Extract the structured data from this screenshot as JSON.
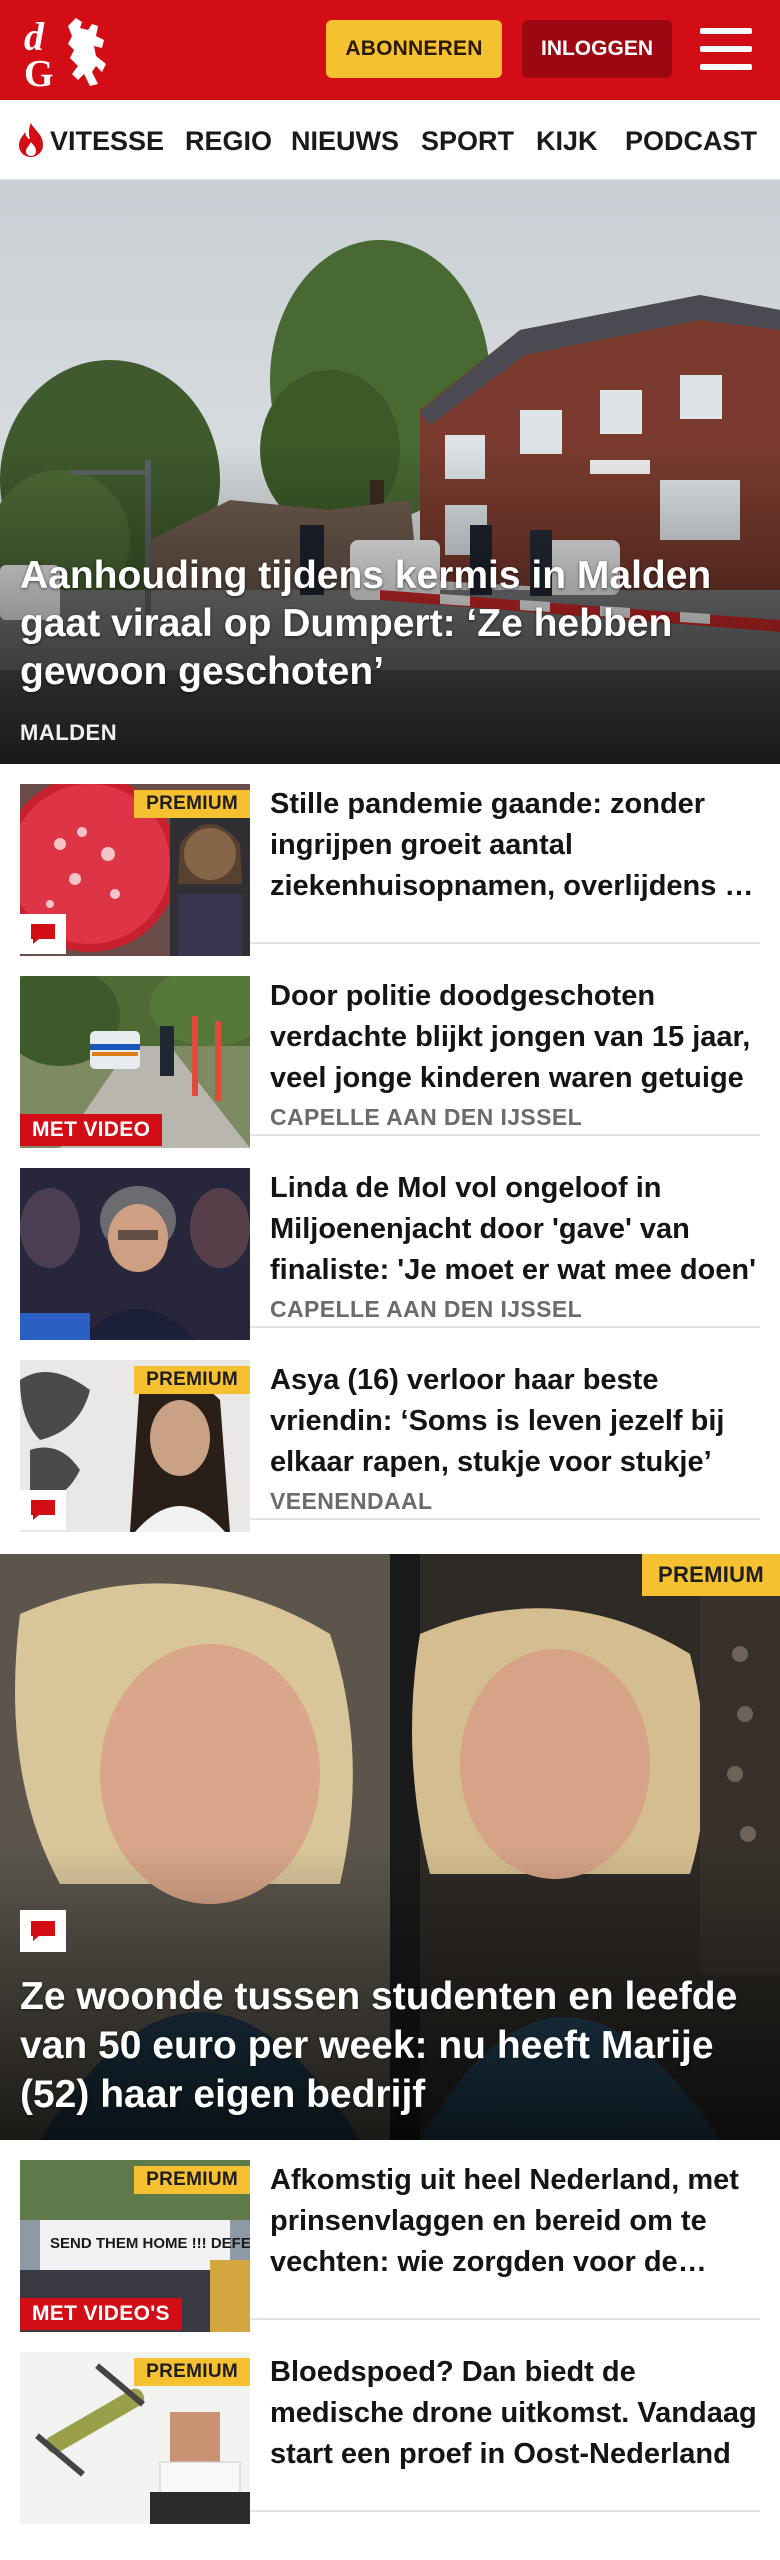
{
  "header": {
    "logo_text": "dG",
    "subscribe_label": "ABONNEREN",
    "login_label": "INLOGGEN"
  },
  "nav": {
    "items": [
      "VITESSE",
      "REGIO",
      "NIEUWS",
      "SPORT",
      "KIJK",
      "PODCAST"
    ]
  },
  "hero": {
    "title": "Aanhouding tijdens kermis in Malden gaat viraal op Dumpert: ‘Ze hebben gewoon geschoten’",
    "location": "MALDEN"
  },
  "articles": [
    {
      "title": "Stille pandemie gaande: zonder ingrijpen groeit aantal ziekenhuisopnamen, overlijdens en kosten explosief",
      "location": "",
      "premium_badge": "PREMIUM",
      "video_badge": "",
      "has_comment_icon": true
    },
    {
      "title": "Door politie doodgeschoten verdachte blijkt jongen van 15 jaar, veel jonge kinderen waren getuige",
      "location": "CAPELLE AAN DEN IJSSEL",
      "premium_badge": "",
      "video_badge": "MET VIDEO",
      "has_comment_icon": false
    },
    {
      "title": "Linda de Mol vol ongeloof in Miljoenenjacht door 'gave' van finaliste: 'Je moet er wat mee doen'",
      "location": "CAPELLE AAN DEN IJSSEL",
      "premium_badge": "",
      "video_badge": "",
      "has_comment_icon": false
    },
    {
      "title": "Asya (16) verloor haar beste vriendin: ‘Soms is leven jezelf bij elkaar rapen, stukje voor stukje’",
      "location": "VEENENDAAL",
      "premium_badge": "PREMIUM",
      "video_badge": "",
      "has_comment_icon": true
    }
  ],
  "feature": {
    "premium_badge": "PREMIUM",
    "title": "Ze woonde tussen studenten en leefde van 50 euro per week: nu heeft Marije (52) haar eigen bedrijf"
  },
  "articles_bottom": [
    {
      "title": "Afkomstig uit heel Nederland, met prinsenvlaggen en bereid om te vechten: wie zorgden voor de onrust",
      "premium_badge": "PREMIUM",
      "video_badge": "MET VIDEO'S",
      "sign_text": "SEND THEM HOME !!!  DEFEND"
    },
    {
      "title": "Bloedspoed? Dan biedt de medische drone uitkomst. Vandaag start een proef in Oost-Nederland",
      "premium_badge": "PREMIUM",
      "video_badge": ""
    }
  ],
  "colors": {
    "brand_red": "#d30d16",
    "dark_red": "#9d0712",
    "premium_yellow": "#f5c131"
  },
  "icons": [
    "dg-logo-icon",
    "hamburger-menu-icon",
    "flame-icon",
    "comment-icon"
  ]
}
